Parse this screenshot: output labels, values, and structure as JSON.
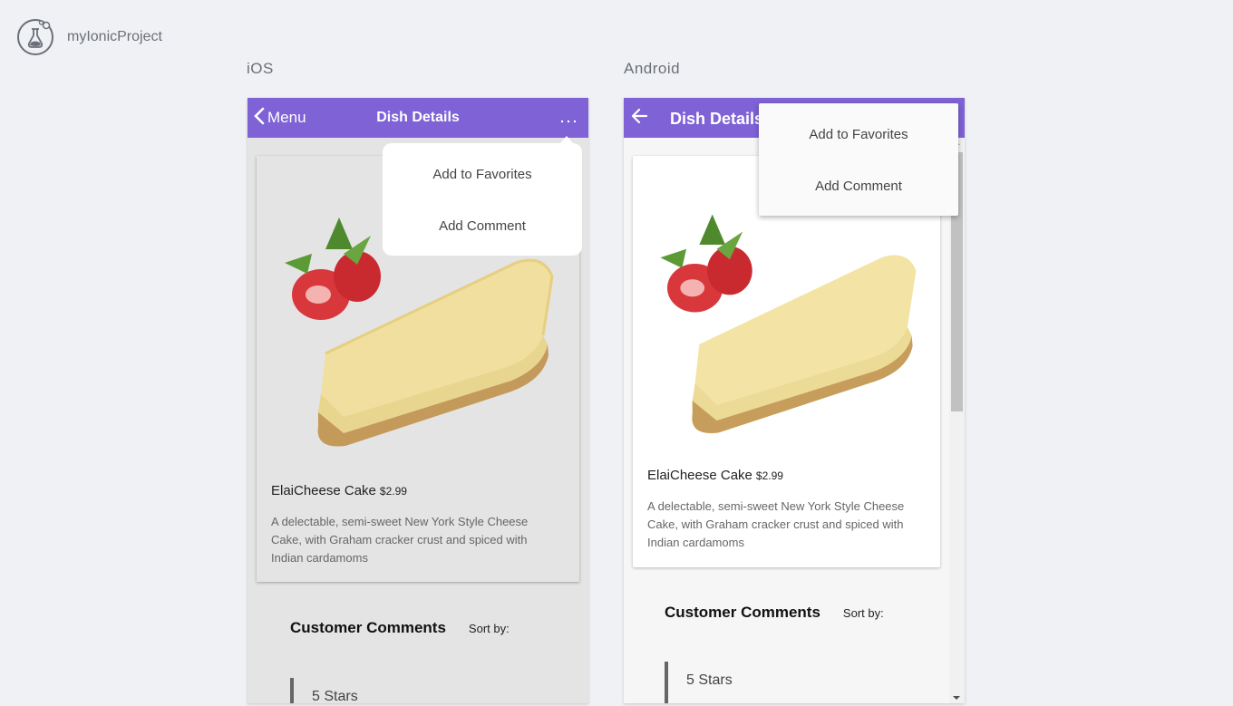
{
  "app": {
    "title": "myIonicProject",
    "logo_icon": "ionic-flask-icon"
  },
  "platforms": {
    "ios_label": "iOS",
    "android_label": "Android"
  },
  "ios": {
    "toolbar": {
      "back_label": "Menu",
      "title": "Dish Details",
      "more_icon": "ellipsis-icon",
      "back_icon": "chevron-left-icon"
    },
    "popover": {
      "items": [
        "Add to Favorites",
        "Add Comment"
      ]
    },
    "dish": {
      "name": "ElaiCheese Cake",
      "price": "$2.99",
      "description": "A delectable, semi-sweet New York Style Cheese Cake, with Graham cracker crust and spiced with Indian cardamoms"
    },
    "comments": {
      "title": "Customer Comments",
      "sort_label": "Sort by:",
      "first_rating": "5 Stars"
    }
  },
  "android": {
    "toolbar": {
      "title": "Dish Details",
      "back_icon": "arrow-left-icon"
    },
    "popover": {
      "items": [
        "Add to Favorites",
        "Add Comment"
      ]
    },
    "dish": {
      "name": "ElaiCheese Cake",
      "price": "$2.99",
      "description": "A delectable, semi-sweet New York Style Cheese Cake, with Graham cracker crust and spiced with Indian cardamoms"
    },
    "comments": {
      "title": "Customer Comments",
      "sort_label": "Sort by:",
      "first_rating": "5 Stars"
    }
  },
  "colors": {
    "toolbar": "#7e62d6",
    "background": "#f0f1f5"
  }
}
